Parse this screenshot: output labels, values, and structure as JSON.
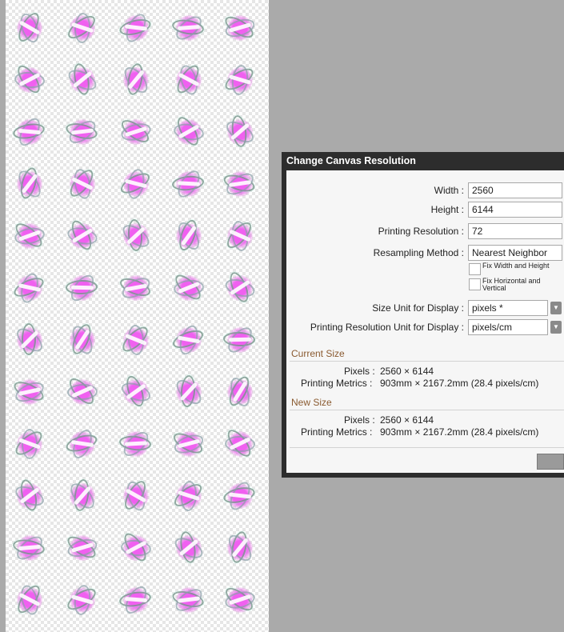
{
  "dialog": {
    "title": "Change Canvas Resolution",
    "width_label": "Width :",
    "width_value": "2560",
    "height_label": "Height :",
    "height_value": "6144",
    "print_res_label": "Printing Resolution :",
    "print_res_value": "72",
    "resample_label": "Resampling Method :",
    "resample_value": "Nearest Neighbor",
    "fix_wh_label": "Fix Width and Height",
    "fix_hv_label": "Fix Horizontal and Vertical",
    "size_unit_label": "Size Unit for Display :",
    "size_unit_value": "pixels *",
    "res_unit_label": "Printing Resolution Unit for Display :",
    "res_unit_value": "pixels/cm",
    "current_size": {
      "heading": "Current Size",
      "pixels_label": "Pixels :",
      "pixels_value": "2560 × 6144",
      "metrics_label": "Printing Metrics :",
      "metrics_value": "903mm × 2167.2mm (28.4 pixels/cm)"
    },
    "new_size": {
      "heading": "New Size",
      "pixels_label": "Pixels :",
      "pixels_value": "2560 × 6144",
      "metrics_label": "Printing Metrics :",
      "metrics_value": "903mm × 2167.2mm (28.4 pixels/cm)"
    }
  },
  "canvas": {
    "columns": 5,
    "rows": 12,
    "colors": {
      "glow": "#f060f0",
      "background": "#aaaaaa"
    }
  }
}
